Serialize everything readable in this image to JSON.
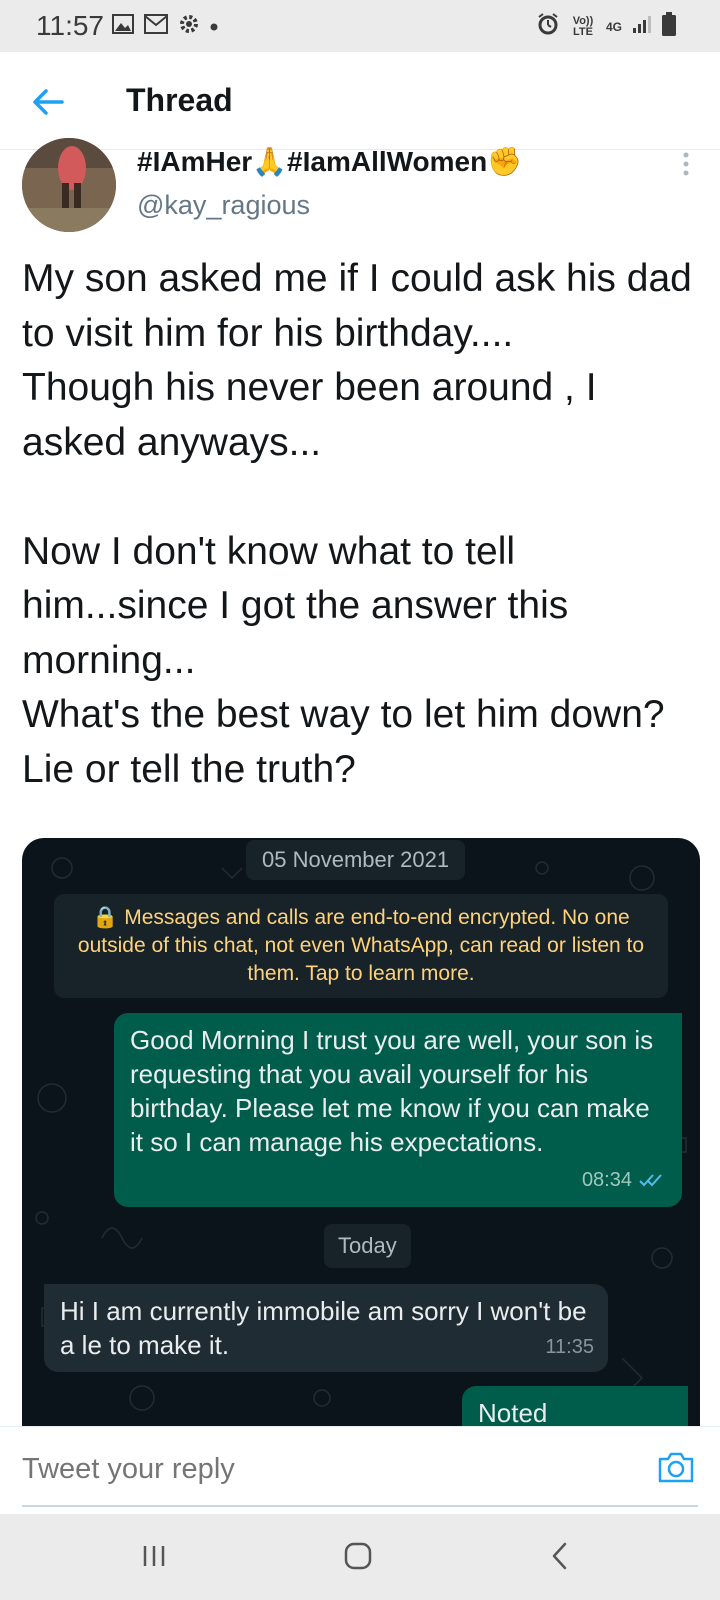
{
  "status_bar": {
    "time": "11:57",
    "left_icons": [
      "image-icon",
      "gmail-icon",
      "settings-icon",
      "dot-icon"
    ],
    "right_icons": [
      "alarm-icon",
      "volte-icon",
      "4g-icon",
      "signal-icon",
      "battery-icon"
    ],
    "volte_label": "Vo)) LTE",
    "network_label": "4G"
  },
  "header": {
    "title": "Thread",
    "accent_color": "#1da1f2"
  },
  "tweet": {
    "display_name": "#IAmHer🙏#IamAllWomen✊",
    "handle": "@kay_ragious",
    "text": "My son asked me if I could ask his dad to visit him for his birthday....\nThough his never been around , I asked anyways...\n\nNow I don't know what to tell him...since I got the answer this morning...\nWhat's the best way to let him down? Lie or tell the truth?"
  },
  "media": {
    "date_chip": "05 November 2021",
    "encryption_notice": "🔒 Messages and calls are end-to-end encrypted. No one outside of this chat, not even WhatsApp, can read or listen to them. Tap to learn more.",
    "messages": [
      {
        "direction": "outgoing",
        "text": "Good Morning I trust you are well, your son is requesting that you avail yourself for his birthday. Please let me know if you can make it so I can manage his expectations.",
        "time": "08:34",
        "read": true
      },
      {
        "direction": "incoming",
        "text": "Hi I am currently immobile am sorry I won't be a le to make it.",
        "time": "11:35"
      },
      {
        "direction": "outgoing",
        "text": "Noted",
        "time": ""
      }
    ],
    "today_chip": "Today"
  },
  "reply": {
    "placeholder": "Tweet your reply"
  },
  "nav": {
    "buttons": [
      "recents-icon",
      "home-icon",
      "back-icon"
    ]
  }
}
